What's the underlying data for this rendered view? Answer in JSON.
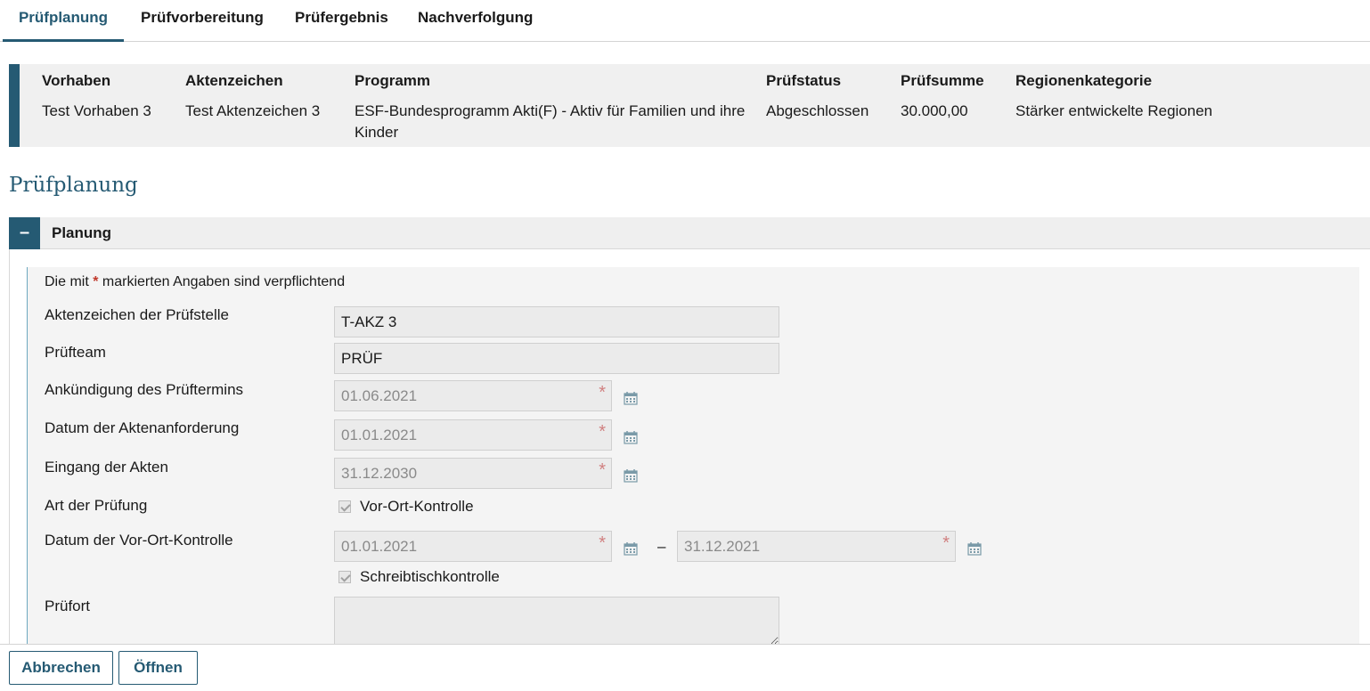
{
  "tabs": [
    {
      "label": "Prüfplanung",
      "active": true
    },
    {
      "label": "Prüfvorbereitung"
    },
    {
      "label": "Prüfergebnis"
    },
    {
      "label": "Nachverfolgung"
    }
  ],
  "summary": {
    "vorhaben": {
      "header": "Vorhaben",
      "value": "Test Vorhaben 3"
    },
    "aktenzeichen": {
      "header": "Aktenzeichen",
      "value": "Test Aktenzeichen 3"
    },
    "programm": {
      "header": "Programm",
      "value": "ESF-Bundesprogramm Akti(F) - Aktiv für Familien und ihre Kinder"
    },
    "pruefstatus": {
      "header": "Prüfstatus",
      "value": "Abgeschlossen"
    },
    "pruefsumme": {
      "header": "Prüfsumme",
      "value": "30.000,00"
    },
    "regionenkategorie": {
      "header": "Regionenkategorie",
      "value": "Stärker entwickelte Regionen"
    }
  },
  "page_title": "Prüfplanung",
  "panel": {
    "toggle": "–",
    "title": "Planung",
    "required_note_prefix": "Die mit",
    "required_star": "*",
    "required_note_suffix": "markierten Angaben sind verpflichtend"
  },
  "form": {
    "aktenzeichen_pruefstelle": {
      "label": "Aktenzeichen der Prüfstelle",
      "value": "T-AKZ 3"
    },
    "prueffteam": {
      "label": "Prüfteam",
      "value": "PRÜF"
    },
    "ankuendigung": {
      "label": "Ankündigung des Prüftermins",
      "value": "01.06.2021"
    },
    "aktenanforderung": {
      "label": "Datum der Aktenanforderung",
      "value": "01.01.2021"
    },
    "eingang_akten": {
      "label": "Eingang der Akten",
      "value": "31.12.2030"
    },
    "art_pruefung": {
      "label": "Art der Prüfung",
      "option_vor_ort": "Vor-Ort-Kontrolle",
      "option_schreibtisch": "Schreibtischkontrolle"
    },
    "datum_vor_ort": {
      "label": "Datum der Vor-Ort-Kontrolle",
      "from": "01.01.2021",
      "separator": "–",
      "to": "31.12.2021"
    },
    "pruefort": {
      "label": "Prüfort",
      "value": ""
    }
  },
  "footer": {
    "cancel_label": "Abbrechen",
    "open_label": "Öffnen"
  },
  "colors": {
    "accent": "#255a73",
    "required_star": "#c0392b"
  }
}
